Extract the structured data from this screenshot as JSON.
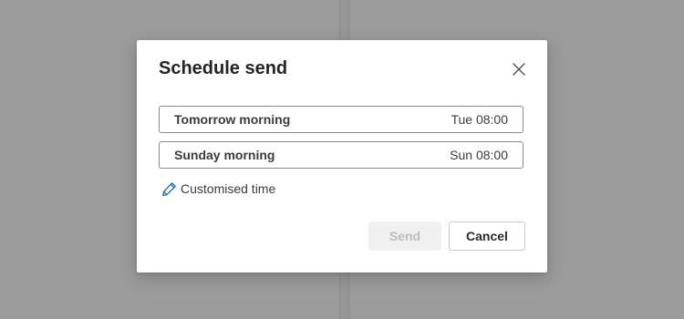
{
  "dialog": {
    "title": "Schedule send",
    "options": [
      {
        "label": "Tomorrow morning",
        "time": "Tue 08:00"
      },
      {
        "label": "Sunday morning",
        "time": "Sun 08:00"
      }
    ],
    "custom_time_label": "Customised time",
    "send_label": "Send",
    "cancel_label": "Cancel",
    "close_icon": "close-icon",
    "pencil_icon": "pencil-icon",
    "colors": {
      "accent": "#0f6cbd",
      "backdrop": "#9b9b9b",
      "disabled_text": "#bdbdbd"
    }
  }
}
